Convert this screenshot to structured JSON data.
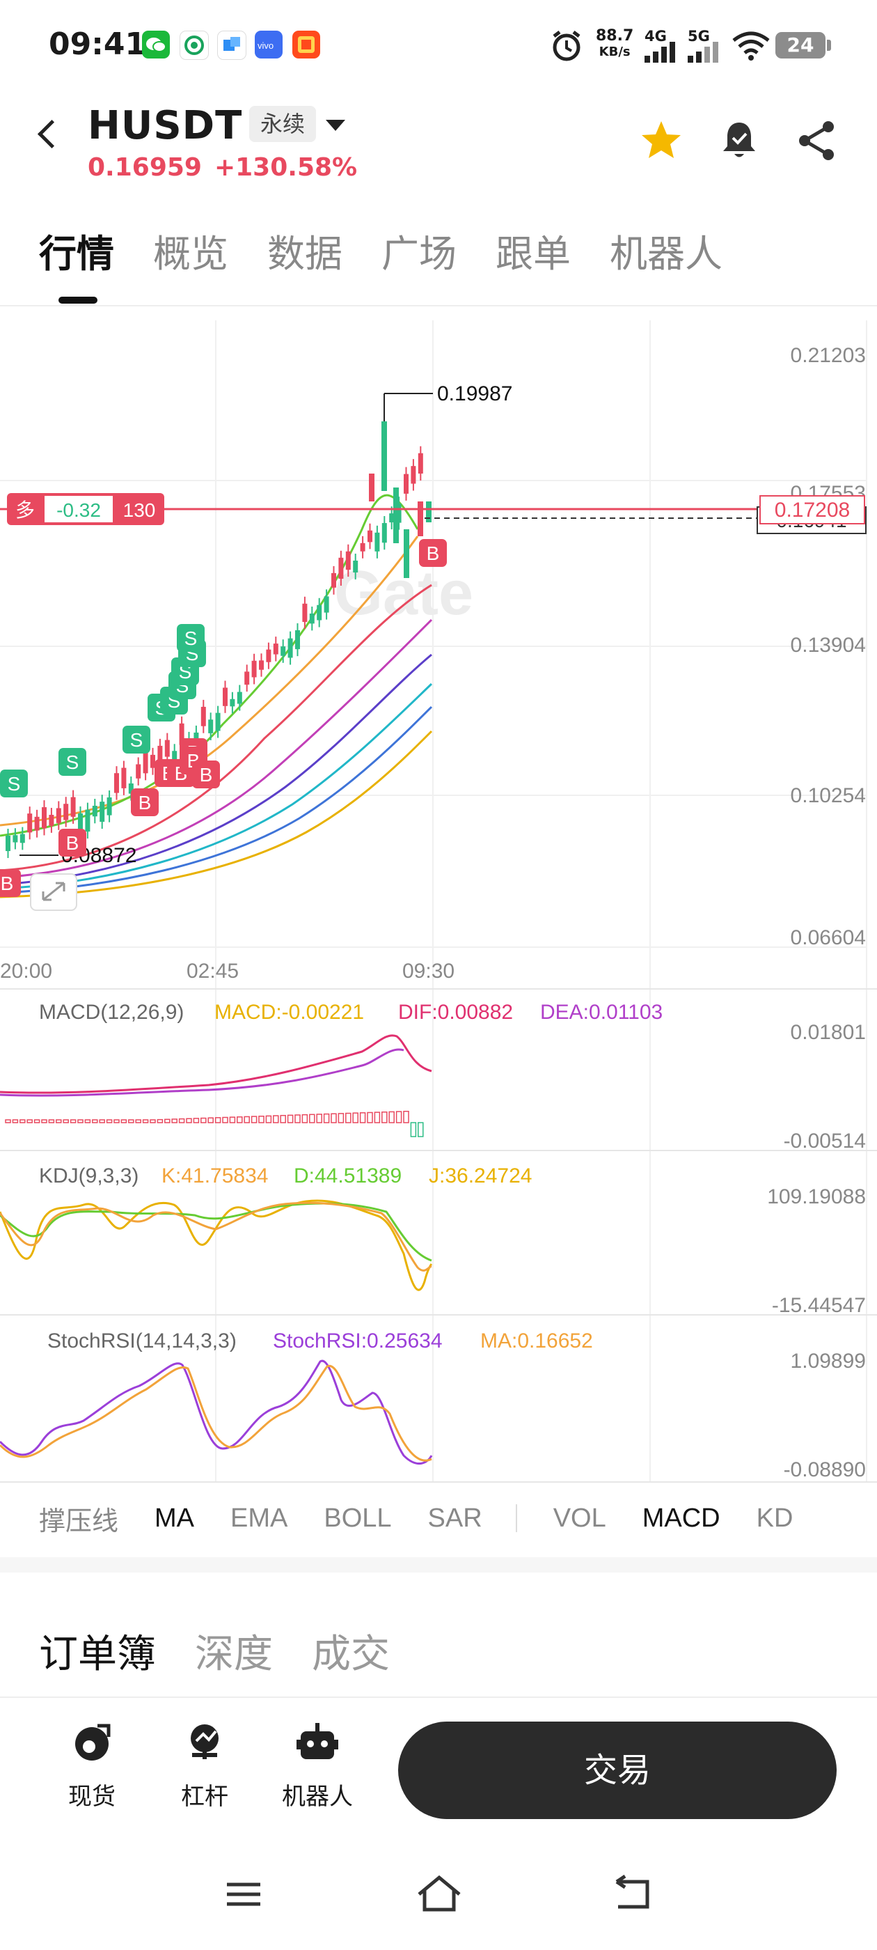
{
  "status_bar": {
    "time": "09:41",
    "net_speed_value": "88.7",
    "net_speed_unit": "KB/s",
    "signal1": "4G",
    "signal2": "5G",
    "battery": "24",
    "app_icons": [
      "wechat-icon",
      "mobile-icon",
      "alipay-icon",
      "vivo-icon",
      "taobao-icon"
    ]
  },
  "header": {
    "pair": "HUSDT",
    "contract_type": "永续",
    "price": "0.16959",
    "change": "+130.58%",
    "colors": {
      "down_red": "#e8495f",
      "up_green": "#2dbd85",
      "star": "#f5b800"
    }
  },
  "tabs": [
    "行情",
    "概览",
    "数据",
    "广场",
    "跟单",
    "机器人"
  ],
  "chart": {
    "watermark": "Gate",
    "price_axis": [
      "0.21203",
      "0.17553",
      "0.13904",
      "0.10254",
      "0.06604"
    ],
    "current_price_tag": "0.17208",
    "hidden_price_tag": "0.16941",
    "high_label": "0.19987",
    "low_label": "0.08872",
    "time_axis": [
      "20:00",
      "02:45",
      "09:30"
    ],
    "position": {
      "side": "多",
      "pnl": "-0.32",
      "size": "130"
    },
    "markers": {
      "sell": "S",
      "buy": "B"
    }
  },
  "chart_data": {
    "type": "line",
    "title": "",
    "x": [
      "20:00",
      "02:45",
      "09:30"
    ],
    "ylim": [
      0.06604,
      0.21203
    ],
    "series": [
      {
        "name": "",
        "values": []
      }
    ],
    "annotations": [
      "0.19987",
      "0.08872",
      "0.17208"
    ]
  },
  "macd": {
    "label": "MACD(12,26,9)",
    "macd": "MACD:-0.00221",
    "dif": "DIF:0.00882",
    "dea": "DEA:0.01103",
    "axis_top": "0.01801",
    "axis_bottom": "-0.00514"
  },
  "kdj": {
    "label": "KDJ(9,3,3)",
    "k": "K:41.75834",
    "d": "D:44.51389",
    "j": "J:36.24724",
    "axis_top": "109.19088",
    "axis_bottom": "-15.44547"
  },
  "stochrsi": {
    "label": "StochRSI(14,14,3,3)",
    "value": "StochRSI:0.25634",
    "ma": "MA:0.16652",
    "axis_top": "1.09899",
    "axis_bottom": "-0.08890"
  },
  "indicator_bar": [
    "撑压线",
    "MA",
    "EMA",
    "BOLL",
    "SAR",
    "VOL",
    "MACD",
    "KD"
  ],
  "orderbook_tabs": [
    "订单簿",
    "深度",
    "成交"
  ],
  "bottom_nav": {
    "spot": "现货",
    "margin": "杠杆",
    "bot": "机器人",
    "trade": "交易"
  }
}
